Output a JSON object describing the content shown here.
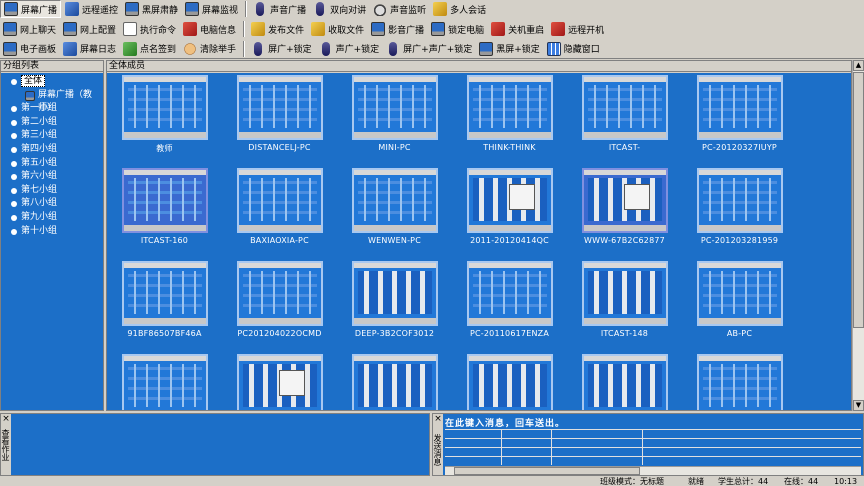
{
  "toolbar_row1": [
    {
      "label": "屏幕广播",
      "icon": "screen-broadcast-icon",
      "active": true
    },
    {
      "label": "远程遥控",
      "icon": "remote-control-icon"
    },
    {
      "label": "黑屏肃静",
      "icon": "black-screen-icon"
    },
    {
      "label": "屏幕监视",
      "icon": "screen-monitor-icon"
    },
    {
      "label": "声音广播",
      "icon": "mic-icon"
    },
    {
      "label": "双向对讲",
      "icon": "mic-icon"
    },
    {
      "label": "声音监听",
      "icon": "headphones-icon"
    },
    {
      "label": "多人会话",
      "icon": "group-chat-icon"
    }
  ],
  "toolbar_row2": [
    {
      "label": "网上聊天",
      "icon": "chat-icon"
    },
    {
      "label": "网上配置",
      "icon": "config-icon"
    },
    {
      "label": "执行命令",
      "icon": "command-icon"
    },
    {
      "label": "电脑信息",
      "icon": "pc-info-icon"
    },
    {
      "label": "发布文件",
      "icon": "publish-file-icon"
    },
    {
      "label": "收取文件",
      "icon": "collect-file-icon"
    },
    {
      "label": "影音广播",
      "icon": "video-broadcast-icon"
    },
    {
      "label": "锁定电脑",
      "icon": "lock-pc-icon"
    },
    {
      "label": "关机重启",
      "icon": "shutdown-icon"
    },
    {
      "label": "远程开机",
      "icon": "remote-boot-icon"
    }
  ],
  "toolbar_row3": [
    {
      "label": "电子画板",
      "icon": "whiteboard-icon"
    },
    {
      "label": "屏幕日志",
      "icon": "screen-log-icon"
    },
    {
      "label": "点名签到",
      "icon": "roll-call-icon"
    },
    {
      "label": "清除举手",
      "icon": "hand-icon"
    },
    {
      "label": "屏广+锁定",
      "icon": "mic-icon"
    },
    {
      "label": "声广+锁定",
      "icon": "mic-icon"
    },
    {
      "label": "屏广+声广+锁定",
      "icon": "mic-icon"
    },
    {
      "label": "黑屏+锁定",
      "icon": "black-screen-icon"
    },
    {
      "label": "隐藏窗口",
      "icon": "hide-window-icon"
    }
  ],
  "left_panel": {
    "title": "分组列表",
    "items": [
      {
        "label": "全体",
        "selected": true
      },
      {
        "label": "屏幕广播（教师）",
        "child": true
      },
      {
        "label": "第一小组"
      },
      {
        "label": "第二小组"
      },
      {
        "label": "第三小组"
      },
      {
        "label": "第四小组"
      },
      {
        "label": "第五小组"
      },
      {
        "label": "第六小组"
      },
      {
        "label": "第七小组"
      },
      {
        "label": "第八小组"
      },
      {
        "label": "第九小组"
      },
      {
        "label": "第十小组"
      }
    ]
  },
  "main_panel": {
    "title": "全体成员",
    "members": [
      "教师",
      "DISTANCELJ-PC",
      "MINI-PC",
      "THINK-THINK",
      "ITCAST-",
      "PC-20120327IUYP",
      "ITCAST-160",
      "BAXIAOXIA-PC",
      "WENWEN-PC",
      "2011-20120414QC",
      "WWW-67B2C62877",
      "PC-201203281959",
      "91BF86507BF46A",
      "PC201204022OCMD",
      "DEEP-3B2COF3012",
      "PC-20110617ENZA",
      "ITCAST-148",
      "AB-PC",
      "",
      "",
      "",
      "",
      "",
      ""
    ]
  },
  "bottom_left": {
    "title": "查看作业",
    "close": "×"
  },
  "bottom_right": {
    "title": "发送消息",
    "close": "×",
    "input_value": "在此键入消息，回车送出。"
  },
  "statusbar": {
    "mode": "班级模式：无标题",
    "status1": "就绪",
    "count": "学生总计：44",
    "online": "在线：44",
    "time": "10:13"
  },
  "colors": {
    "accent": "#1c6fc8",
    "chrome": "#d4d0c8"
  }
}
